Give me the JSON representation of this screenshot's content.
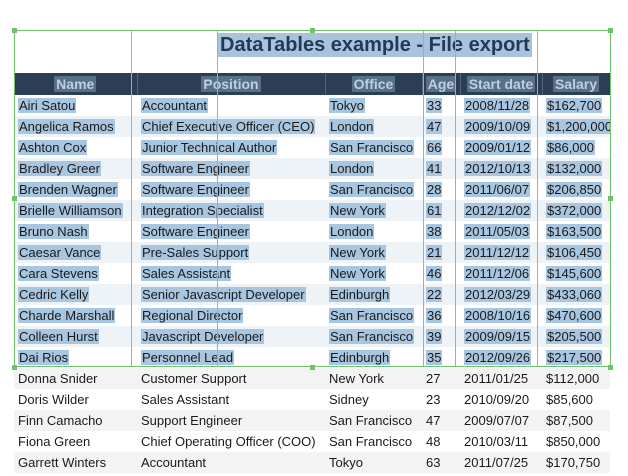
{
  "title": "DataTables example - File export",
  "table": {
    "headers": [
      "Name",
      "Position",
      "Office",
      "Age",
      "Start date",
      "Salary"
    ],
    "rows": [
      [
        "Airi Satou",
        "Accountant",
        "Tokyo",
        "33",
        "2008/11/28",
        "$162,700"
      ],
      [
        "Angelica Ramos",
        "Chief Executive Officer (CEO)",
        "London",
        "47",
        "2009/10/09",
        "$1,200,000"
      ],
      [
        "Ashton Cox",
        "Junior Technical Author",
        "San Francisco",
        "66",
        "2009/01/12",
        "$86,000"
      ],
      [
        "Bradley Greer",
        "Software Engineer",
        "London",
        "41",
        "2012/10/13",
        "$132,000"
      ],
      [
        "Brenden Wagner",
        "Software Engineer",
        "San Francisco",
        "28",
        "2011/06/07",
        "$206,850"
      ],
      [
        "Brielle Williamson",
        "Integration Specialist",
        "New York",
        "61",
        "2012/12/02",
        "$372,000"
      ],
      [
        "Bruno Nash",
        "Software Engineer",
        "London",
        "38",
        "2011/05/03",
        "$163,500"
      ],
      [
        "Caesar Vance",
        "Pre-Sales Support",
        "New York",
        "21",
        "2011/12/12",
        "$106,450"
      ],
      [
        "Cara Stevens",
        "Sales Assistant",
        "New York",
        "46",
        "2011/12/06",
        "$145,600"
      ],
      [
        "Cedric Kelly",
        "Senior Javascript Developer",
        "Edinburgh",
        "22",
        "2012/03/29",
        "$433,060"
      ],
      [
        "Charde Marshall",
        "Regional Director",
        "San Francisco",
        "36",
        "2008/10/16",
        "$470,600"
      ],
      [
        "Colleen Hurst",
        "Javascript Developer",
        "San Francisco",
        "39",
        "2009/09/15",
        "$205,500"
      ],
      [
        "Dai Rios",
        "Personnel Lead",
        "Edinburgh",
        "35",
        "2012/09/26",
        "$217,500"
      ],
      [
        "Donna Snider",
        "Customer Support",
        "New York",
        "27",
        "2011/01/25",
        "$112,000"
      ],
      [
        "Doris Wilder",
        "Sales Assistant",
        "Sidney",
        "23",
        "2010/09/20",
        "$85,600"
      ],
      [
        "Finn Camacho",
        "Support Engineer",
        "San Francisco",
        "47",
        "2009/07/07",
        "$87,500"
      ],
      [
        "Fiona Green",
        "Chief Operating Officer (COO)",
        "San Francisco",
        "48",
        "2010/03/11",
        "$850,000"
      ],
      [
        "Garrett Winters",
        "Accountant",
        "Tokyo",
        "63",
        "2011/07/25",
        "$170,750"
      ]
    ]
  },
  "selected_row_count": 13,
  "colors": {
    "header_bg": "#2c3e56",
    "selection": "#a8c6e0",
    "guide": "#6cc36c"
  }
}
